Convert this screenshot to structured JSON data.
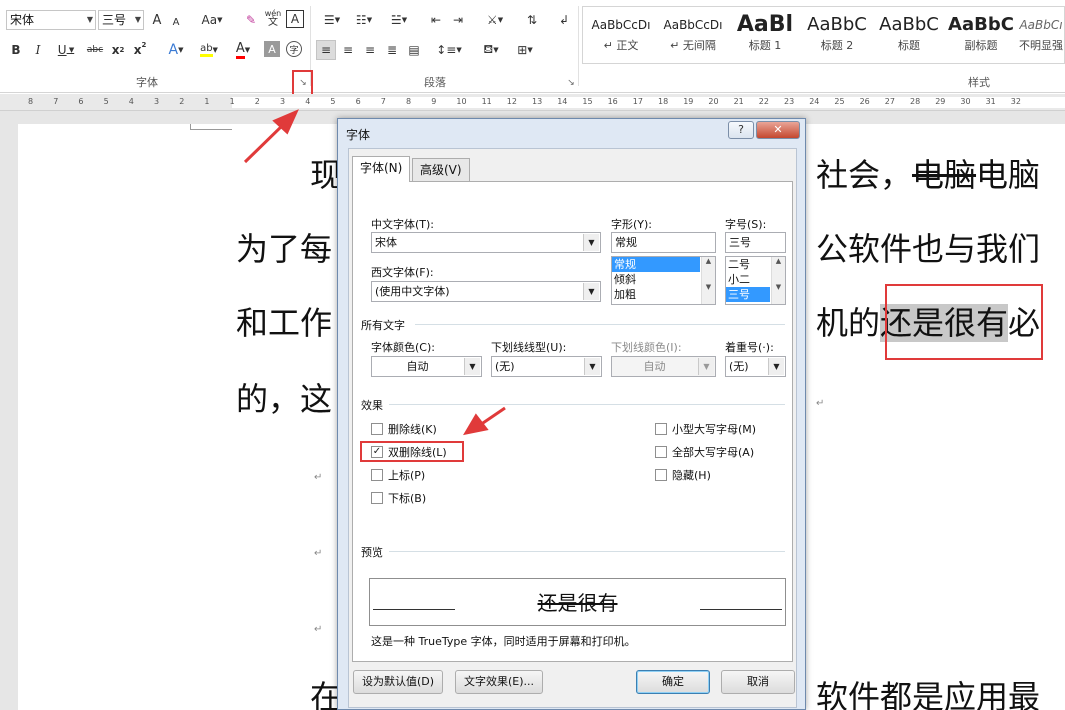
{
  "ribbon": {
    "font_name": "宋体",
    "font_size": "三号",
    "grow_label": "A",
    "shrink_label": "A",
    "case_label": "Aa",
    "phonetic_label": "wén",
    "border_char_label": "A",
    "bold": "B",
    "italic": "I",
    "underline": "U",
    "strike": "abc",
    "subscript": "x",
    "superscript": "x",
    "text_effect": "A",
    "highlight": "ab",
    "font_color": "A",
    "char_shading": "A",
    "enclose": "字",
    "group_font": "字体",
    "group_paragraph": "段落",
    "group_styles": "样式",
    "styles": [
      {
        "sample": "AaBbCcDı",
        "name": "↵ 正文"
      },
      {
        "sample": "AaBbCcDı",
        "name": "↵ 无间隔"
      },
      {
        "sample": "AaBl",
        "name": "标题 1"
      },
      {
        "sample": "AaBbC",
        "name": "标题 2"
      },
      {
        "sample": "AaBbC",
        "name": "标题"
      },
      {
        "sample": "AaBbC",
        "name": "副标题"
      },
      {
        "sample": "AaBbCı",
        "name": "不明显强"
      }
    ],
    "colors": {
      "highlight": "#ffff00",
      "font_color": "#ff0000"
    }
  },
  "ruler": {
    "numbers": [
      "8",
      "7",
      "6",
      "5",
      "4",
      "3",
      "2",
      "1",
      "1",
      "2",
      "3",
      "4",
      "5",
      "6",
      "7",
      "8",
      "9",
      "10",
      "11",
      "12",
      "13",
      "14",
      "15",
      "16",
      "17",
      "18",
      "19",
      "20",
      "21",
      "22",
      "23",
      "24",
      "25",
      "26",
      "27",
      "28",
      "29",
      "30",
      "31",
      "32"
    ]
  },
  "document": {
    "line1_a": "现",
    "line1_b": "社会，",
    "line1_strike": "电脑",
    "line1_c": "电脑",
    "line2_a": "为了每",
    "line2_b": "公软件也与我们",
    "line3_a": "和工作",
    "line3_b": "机的",
    "line3_hl": "还是很有",
    "line3_c": "必",
    "line4_a": "的，这",
    "line5_a": "在",
    "line5_b": "软件都是应用最",
    "para_mark": "↵"
  },
  "dialog": {
    "title": "字体",
    "help": "?",
    "close": "✕",
    "tabs": [
      "字体(N)",
      "高级(V)"
    ],
    "labels": {
      "cn_font": "中文字体(T):",
      "west_font": "西文字体(F):",
      "style": "字形(Y):",
      "size": "字号(S):",
      "all_text": "所有文字",
      "font_color": "字体颜色(C):",
      "underline_type": "下划线线型(U):",
      "underline_color": "下划线颜色(I):",
      "emphasis": "着重号(·):",
      "effects": "效果",
      "preview": "预览"
    },
    "values": {
      "cn_font": "宋体",
      "west_font": "(使用中文字体)",
      "style": "常规",
      "size": "三号",
      "font_color": "自动",
      "underline_type": "(无)",
      "underline_color": "自动",
      "emphasis": "(无)"
    },
    "style_list": [
      "常规",
      "倾斜",
      "加粗"
    ],
    "size_list": [
      "二号",
      "小二",
      "三号"
    ],
    "effects_left": [
      {
        "label": "删除线(K)",
        "checked": false
      },
      {
        "label": "双删除线(L)",
        "checked": true
      },
      {
        "label": "上标(P)",
        "checked": false
      },
      {
        "label": "下标(B)",
        "checked": false
      }
    ],
    "effects_right": [
      {
        "label": "小型大写字母(M)",
        "checked": false
      },
      {
        "label": "全部大写字母(A)",
        "checked": false
      },
      {
        "label": "隐藏(H)",
        "checked": false
      }
    ],
    "preview_text": "还是很有",
    "truetype_note": "这是一种 TrueType 字体，同时适用于屏幕和打印机。",
    "buttons": {
      "set_default": "设为默认值(D)",
      "text_effects": "文字效果(E)...",
      "ok": "确定",
      "cancel": "取消"
    }
  },
  "annotation_color": "#e03a3a"
}
